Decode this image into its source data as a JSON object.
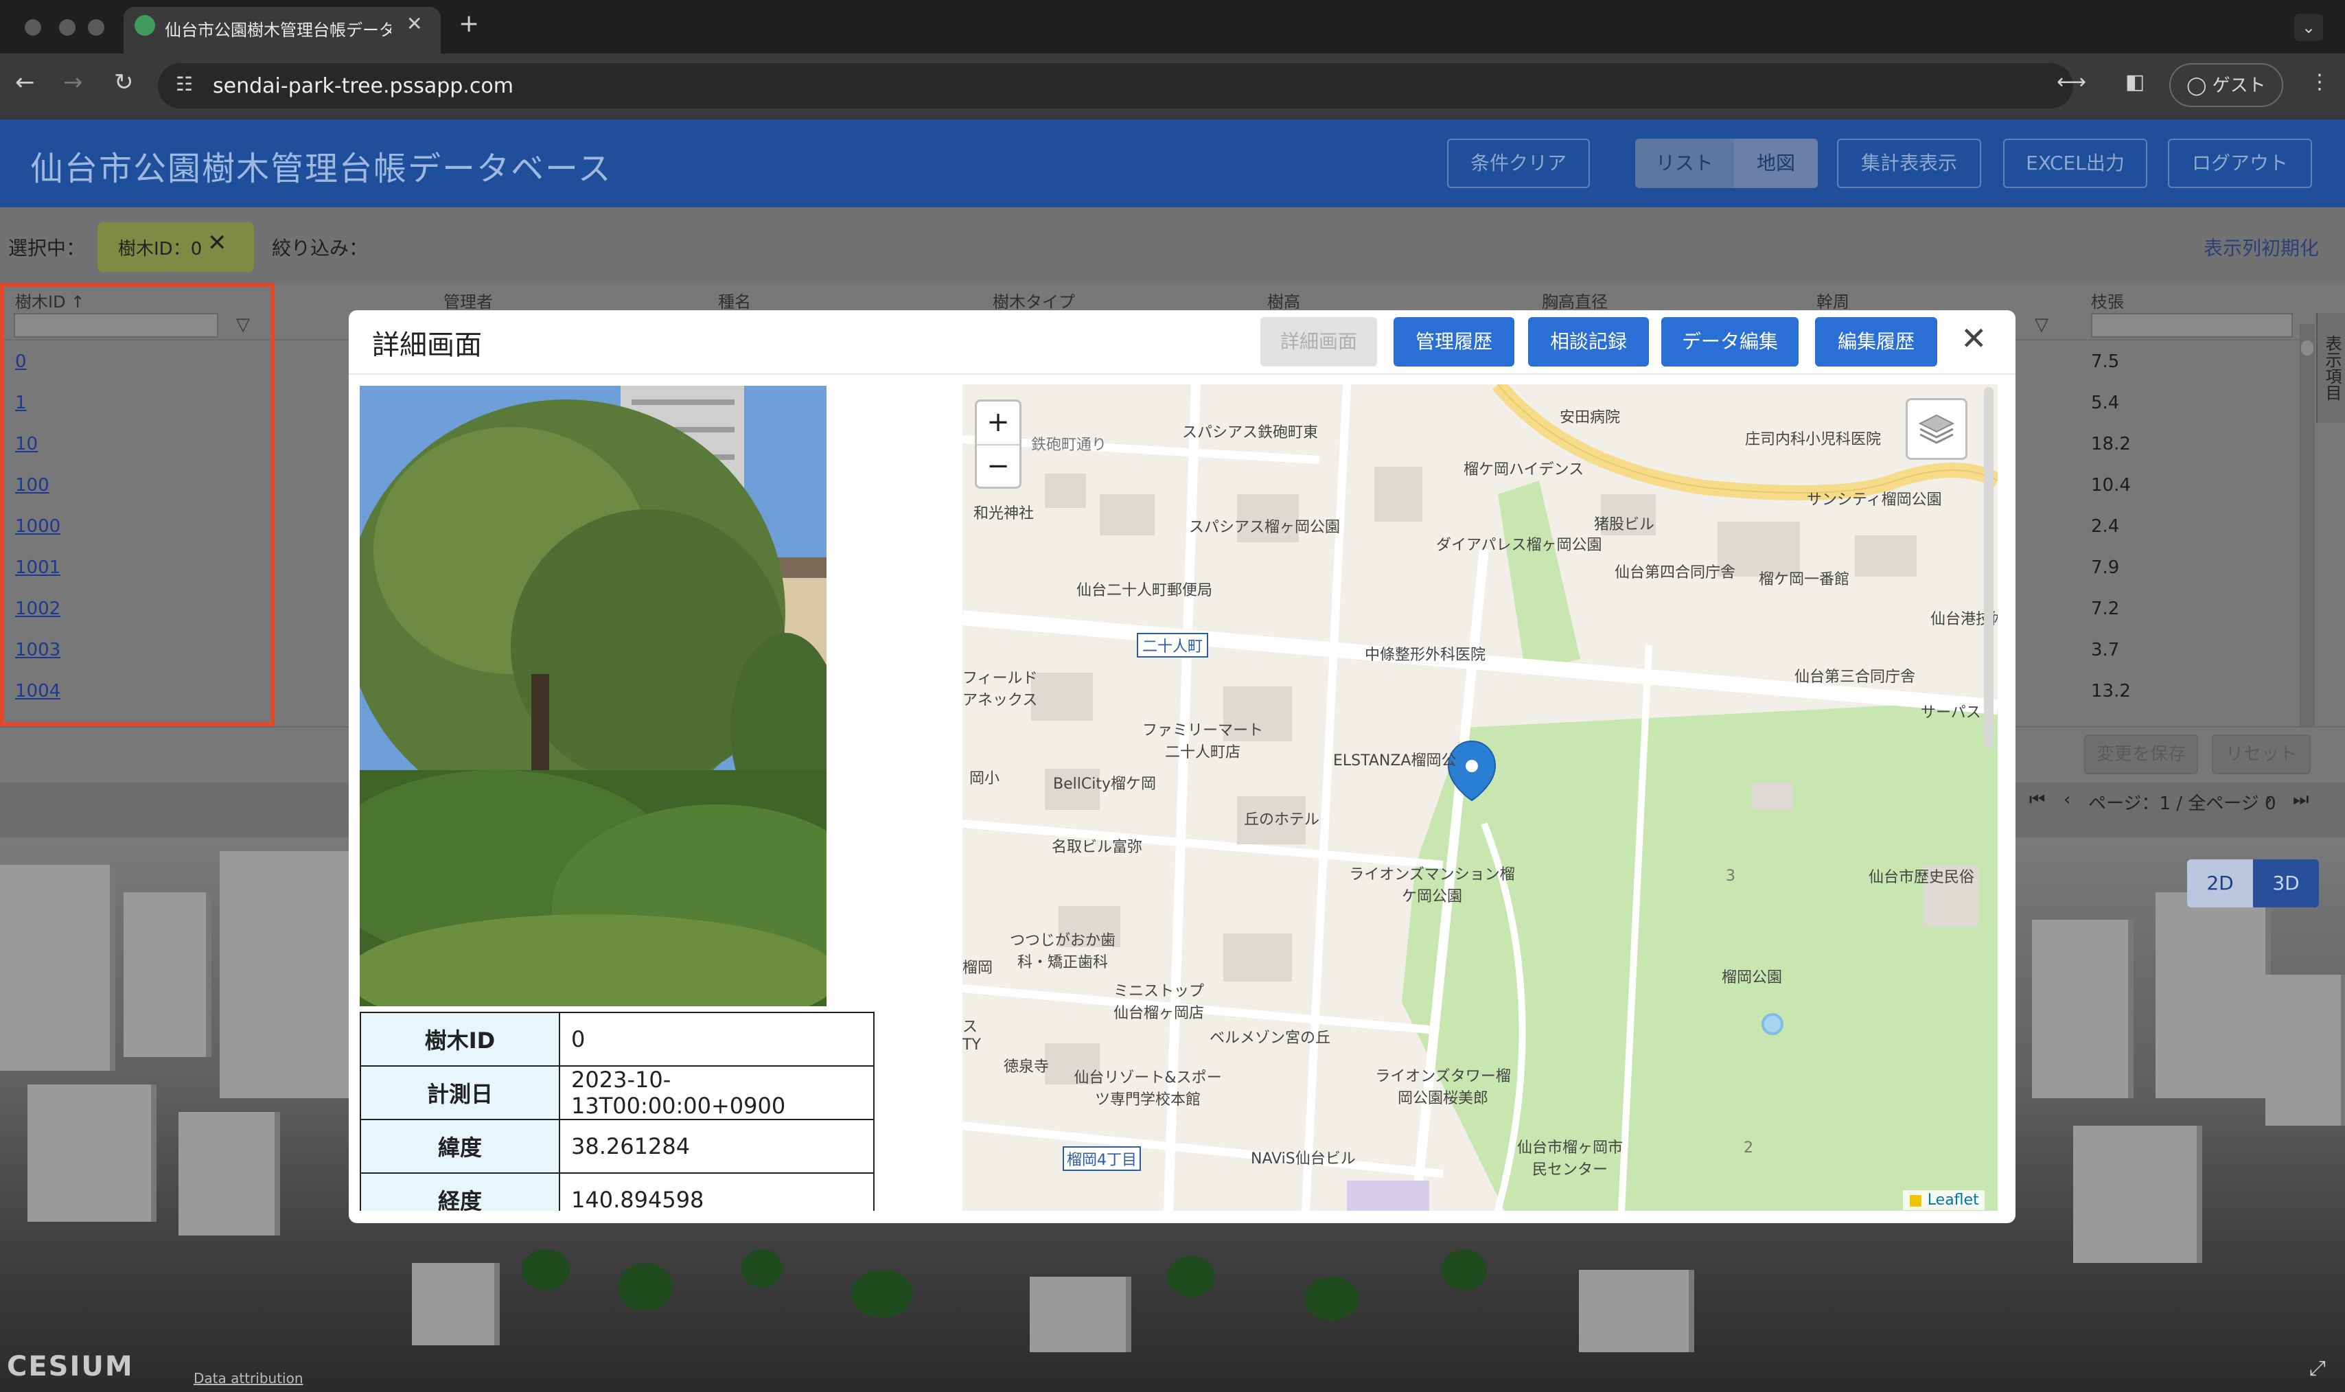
{
  "browser": {
    "tab_title": "仙台市公園樹木管理台帳データベース",
    "url": "sendai-park-tree.pssapp.com",
    "profile": "ゲスト"
  },
  "app": {
    "title": "仙台市公園樹木管理台帳データベース",
    "buttons": {
      "clear": "条件クリア",
      "list": "リスト",
      "map": "地図",
      "summary": "集計表表示",
      "excel": "EXCEL出力",
      "logout": "ログアウト"
    }
  },
  "filters": {
    "selected_label": "選択中：",
    "chip": "樹木ID：0",
    "narrow_label": "絞り込み：",
    "reset_columns": "表示列初期化"
  },
  "table": {
    "headers": [
      "樹木ID ↑",
      "管理者",
      "種名",
      "樹木タイプ",
      "樹高",
      "胸高直径",
      "幹周",
      "枝張"
    ],
    "rows": [
      {
        "id": "0",
        "branch": "7.5"
      },
      {
        "id": "1",
        "branch": "5.4"
      },
      {
        "id": "10",
        "branch": "18.2"
      },
      {
        "id": "100",
        "branch": "10.4"
      },
      {
        "id": "1000",
        "branch": "2.4"
      },
      {
        "id": "1001",
        "branch": "7.9"
      },
      {
        "id": "1002",
        "branch": "7.2"
      },
      {
        "id": "1003",
        "branch": "3.7"
      },
      {
        "id": "1004",
        "branch": "13.2"
      }
    ],
    "side_label": "表示項目",
    "save_button": "変更を保存",
    "reset_button": "リセット",
    "pager_text": "ページ：1 / 全ページ 0"
  },
  "view_toggle": {
    "mode2d": "2D",
    "mode3d": "3D"
  },
  "cesium": {
    "logo": "CESIUM",
    "attribution": "Data attribution"
  },
  "modal": {
    "title": "詳細画面",
    "buttons": {
      "detail": "詳細画面",
      "history": "管理履歴",
      "consult": "相談記録",
      "edit": "データ編集",
      "edit_history": "編集履歴"
    },
    "close": "✕",
    "info": [
      {
        "key": "樹木ID",
        "value": "0"
      },
      {
        "key": "計測日",
        "value": "2023-10-13T00:00:00+0900"
      },
      {
        "key": "緯度",
        "value": "38.261284"
      },
      {
        "key": "経度",
        "value": "140.894598"
      }
    ]
  },
  "map": {
    "zoom_in": "+",
    "zoom_out": "−",
    "attribution": "Leaflet",
    "labels": [
      "安田病院",
      "スパシアス鉄砲町東",
      "鉄砲町通り",
      "庄司内科小児科医院",
      "榴ケ岡ハイデンス",
      "和光神社",
      "スパシアス榴ヶ岡公園",
      "猪股ビル",
      "サンシティ榴岡公園",
      "ダイアパレス榴ヶ岡公園",
      "仙台第四合同庁舎",
      "榴ケ岡一番館",
      "仙台二十人町郵便局",
      "仙台港技術調",
      "二十人町",
      "中條整形外科医院",
      "仙台第三合同庁舎",
      "フィールドアネックス",
      "サーパス",
      "ファミリーマート二十人町店",
      "ELSTANZA榴岡公",
      "BellCity榴ケ岡",
      "丘のホテル",
      "名取ビル富弥",
      "ライオンズマンション榴ケ岡公園",
      "仙台市歴史民俗",
      "つつじがおか歯科・矯正歯科",
      "榴岡公園",
      "ミニストップ仙台榴ヶ岡店",
      "ベルメゾン宮の丘",
      "徳泉寺",
      "仙台リゾート&スポーツ専門学校本館",
      "ライオンズタワー榴岡公園桜美郎",
      "仙台市榴ヶ岡市民センター",
      "NAViS仙台ビル",
      "榴岡4丁目",
      "岡小",
      "榴岡",
      "ス TY",
      "2",
      "3"
    ]
  },
  "colors": {
    "header_blue": "#1f4e9a",
    "button_blue": "#2a6fd6",
    "highlight_red": "#e0482a",
    "park_green": "#c8e6b0",
    "marker_blue": "#2a7fd4"
  }
}
